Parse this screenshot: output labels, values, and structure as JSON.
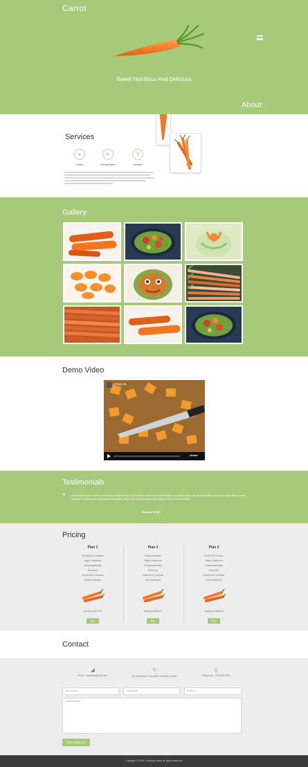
{
  "header": {
    "brand": "Carrot",
    "tagline": "Sweet Nutritious And Delicious",
    "menu_icon": "hamburger-icon"
  },
  "about": {
    "title": "About",
    "services_title": "Services",
    "services": [
      {
        "label": "Lorem",
        "icon": "compass-icon"
      },
      {
        "label": "Consectetur",
        "icon": "pencil-icon"
      },
      {
        "label": "Laoreet",
        "icon": "glass-icon"
      }
    ]
  },
  "gallery": {
    "title": "Gallery"
  },
  "video": {
    "title": "Demo Video",
    "channel": "W3layouts"
  },
  "testimonials": {
    "title": "Testimonials",
    "author": "Bradley Smith",
    "quote": "Lorem ipsum dolor sit amet, consectetur adipiscing elit. Cras porta leo vitae lorem pellentesque, ut volutpat tortor. Sed ut perspiciatis unde omnis iste natus error sit voluptatem accusantium doloremque laudantium, totam rem aperiam eaque ipsa quae ab illo inventore veritatis."
  },
  "pricing": {
    "title": "Pricing",
    "plans": [
      {
        "name": "Plan 1",
        "features": [
          "Email And Compact",
          "Highly Nutritious",
          "Unapologetically",
          "Delicious",
          "Email And Compact",
          "Easily Scalable"
        ],
        "price": "starting at $20.00",
        "button": "Buy"
      },
      {
        "name": "Plan 2",
        "features": [
          "Easily Scalable",
          "Highly Nutritious",
          "Unapologetically",
          "Delicious",
          "Email And Compact",
          "Very Nutritious"
        ],
        "price": "starting at $30.00",
        "button": "Buy"
      },
      {
        "name": "Plan 3",
        "features": [
          "Ideas For Groups",
          "Highly Nutritious",
          "Unapologetically",
          "Delicious",
          "Email And Compact",
          "Very Nutritious"
        ],
        "price": "starting at $40.00",
        "button": "Buy"
      }
    ]
  },
  "contact": {
    "title": "Contact",
    "info": [
      {
        "icon": "megaphone-icon",
        "text": "Email : example@mail.com"
      },
      {
        "icon": "location-pin-icon",
        "text": "AL Parkstreet 70 Av 80th Orchard London"
      },
      {
        "icon": "phone-icon",
        "text": "Telephone : +00 000 0000"
      }
    ],
    "fields": {
      "name": "Your Name",
      "email": "Your Email",
      "subject": "Subject",
      "message": "Your Message"
    },
    "send": "SEND MESSAGE"
  },
  "footer": {
    "copyright": "Copyright © 2016 Company name All rights reserved."
  },
  "colors": {
    "accent": "#a7c97a",
    "footer": "#3b3b3b",
    "grey": "#ededed"
  }
}
